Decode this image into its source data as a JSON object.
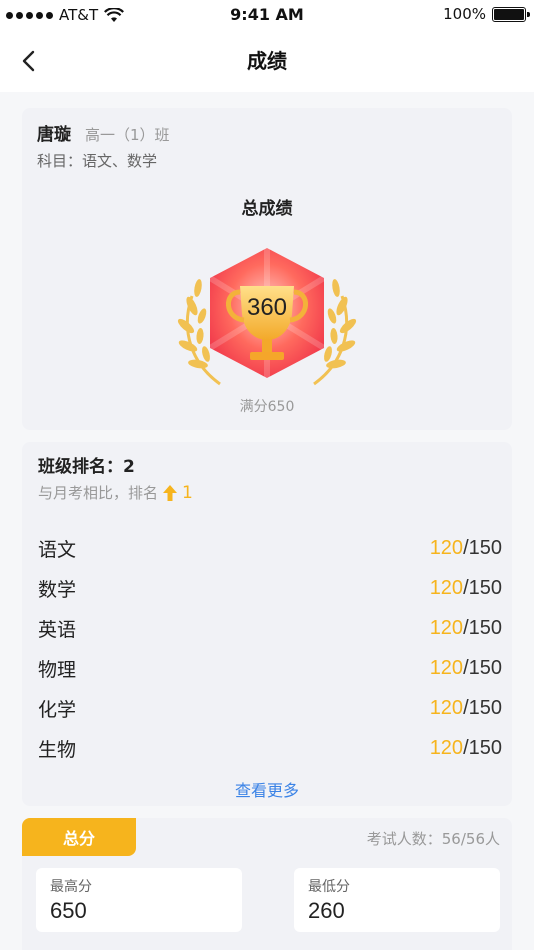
{
  "status_bar": {
    "carrier": "AT&T",
    "time": "9:41 AM",
    "battery": "100%"
  },
  "nav": {
    "title": "成绩",
    "back_icon": "chevron-left-icon"
  },
  "student": {
    "name": "唐璇",
    "class": "高一（1）班",
    "subjects": "科目：语文、数学"
  },
  "total": {
    "title": "总成绩",
    "score": "360",
    "full": "满分650"
  },
  "ranking": {
    "label": "班级排名：2",
    "compare_text": "与月考相比，排名",
    "change": "1",
    "change_icon": "arrow-up-icon"
  },
  "subjects": [
    {
      "name": "语文",
      "score": "120",
      "max": "/150"
    },
    {
      "name": "数学",
      "score": "120",
      "max": "/150"
    },
    {
      "name": "英语",
      "score": "120",
      "max": "/150"
    },
    {
      "name": "物理",
      "score": "120",
      "max": "/150"
    },
    {
      "name": "化学",
      "score": "120",
      "max": "/150"
    },
    {
      "name": "生物",
      "score": "120",
      "max": "/150"
    }
  ],
  "more_label": "查看更多",
  "summary": {
    "tab": "总分",
    "participants": "考试人数：56/56人",
    "highest_label": "最高分",
    "highest_value": "650",
    "lowest_label": "最低分",
    "lowest_value": "260"
  },
  "colors": {
    "accent": "#f6b41d",
    "link": "#3b83e6",
    "card_bg": "#f1f2f6"
  }
}
